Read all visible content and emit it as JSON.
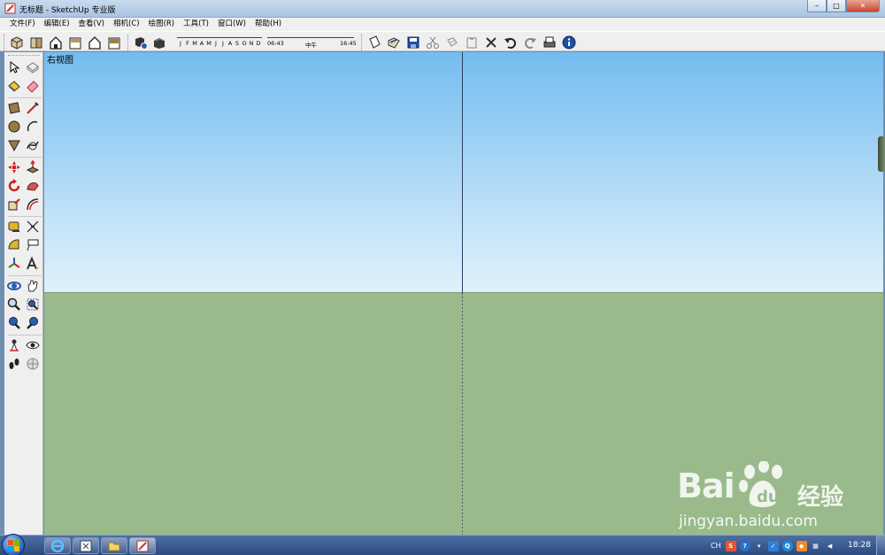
{
  "window": {
    "title": "无标题 - SketchUp 专业版"
  },
  "menu": [
    "文件(F)",
    "编辑(E)",
    "查看(V)",
    "相机(C)",
    "绘图(R)",
    "工具(T)",
    "窗口(W)",
    "帮助(H)"
  ],
  "shadow_settings": {
    "months": [
      "J",
      "F",
      "M",
      "A",
      "M",
      "J",
      "J",
      "A",
      "S",
      "O",
      "N",
      "D"
    ],
    "time_start": "06:43",
    "time_noon": "中午",
    "time_end": "16:45"
  },
  "viewport": {
    "view_label": "右视图"
  },
  "watermark": {
    "brand": "Bai",
    "brand_cn": "经验",
    "url": "jingyan.baidu.com"
  },
  "taskbar": {
    "lang": "CH",
    "clock": "18:28"
  },
  "colors": {
    "sky_top": "#74bcef",
    "sky_bottom": "#dff1fb",
    "ground": "#9aba8c",
    "taskbar": "#2c4a7e"
  },
  "icons": {
    "toolbar": [
      "iso-view-icon",
      "top-view-icon",
      "front-view-icon",
      "right-view-icon",
      "back-view-icon",
      "left-view-icon",
      "shadow-settings-icon",
      "shadow-toggle-icon",
      "new-file-icon",
      "open-file-icon",
      "save-icon",
      "cut-icon",
      "copy-icon",
      "paste-icon",
      "erase-icon",
      "undo-icon",
      "redo-icon",
      "print-icon",
      "model-info-icon"
    ],
    "palette": [
      "select-icon",
      "make-component-icon",
      "paint-bucket-icon",
      "eraser-icon",
      "rectangle-icon",
      "line-icon",
      "circle-icon",
      "arc-icon",
      "polygon-icon",
      "freehand-icon",
      "move-icon",
      "push-pull-icon",
      "rotate-icon",
      "follow-me-icon",
      "scale-icon",
      "offset-icon",
      "tape-measure-icon",
      "dimension-icon",
      "protractor-icon",
      "text-icon",
      "axes-icon",
      "3d-text-icon",
      "orbit-icon",
      "pan-icon",
      "zoom-icon",
      "zoom-window-icon",
      "zoom-extents-icon",
      "previous-view-icon",
      "position-camera-icon",
      "look-around-icon",
      "walk-icon",
      "section-plane-icon"
    ]
  }
}
